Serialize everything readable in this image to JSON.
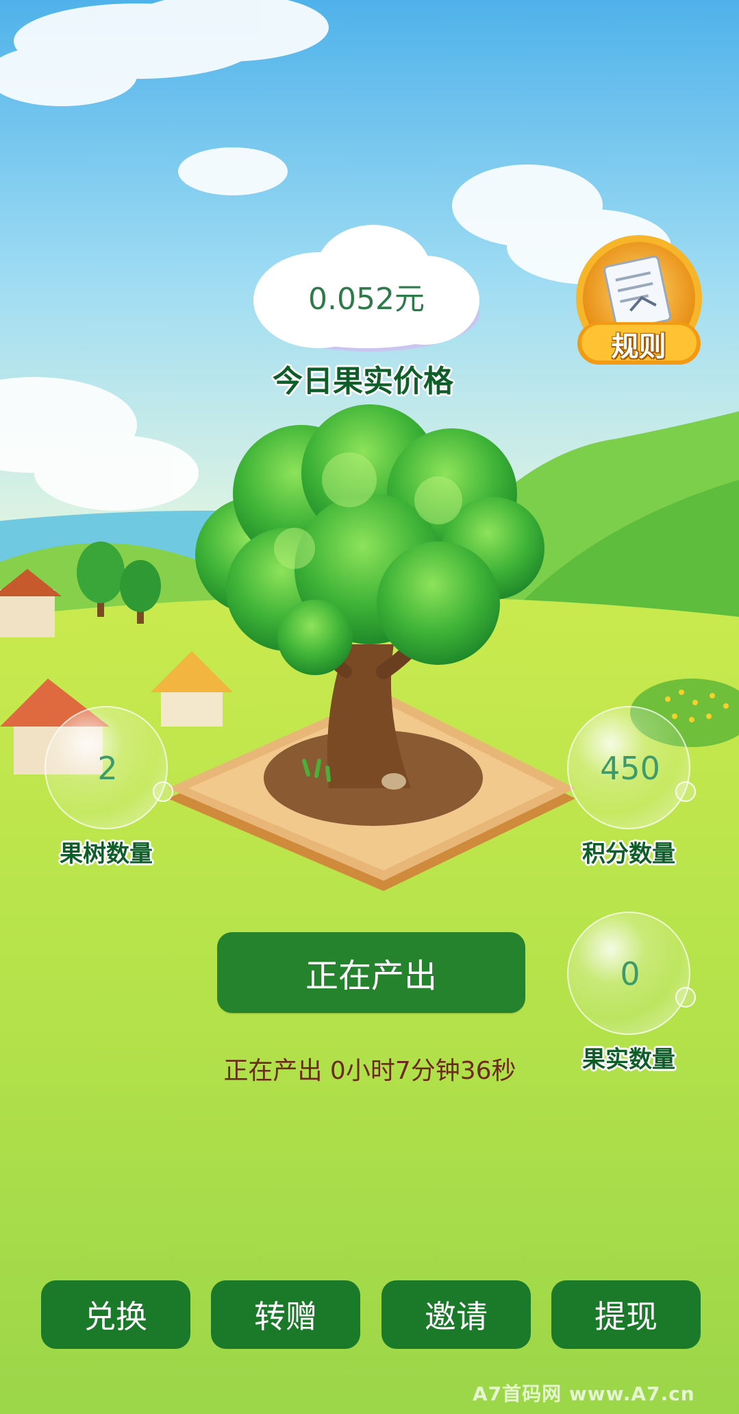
{
  "price": {
    "value": "0.052元",
    "caption": "今日果实价格"
  },
  "rules": {
    "label": "规则",
    "icon": "document-pen-icon"
  },
  "stats": {
    "trees": {
      "value": "2",
      "label": "果树数量"
    },
    "points": {
      "value": "450",
      "label": "积分数量"
    },
    "fruits": {
      "value": "0",
      "label": "果实数量"
    }
  },
  "produce": {
    "button_label": "正在产出",
    "status_text": "正在产出 0小时7分钟36秒"
  },
  "nav": [
    {
      "label": "兑换"
    },
    {
      "label": "转赠"
    },
    {
      "label": "邀请"
    },
    {
      "label": "提现"
    }
  ],
  "watermark": {
    "text": "A7首码网   www.A7.cn"
  },
  "colors": {
    "primary_green": "#25822d",
    "nav_green": "#1b7a2a",
    "label_green": "#0f5e2a",
    "status_brown": "#6b2a1a",
    "badge_orange": "#f2a21a"
  }
}
